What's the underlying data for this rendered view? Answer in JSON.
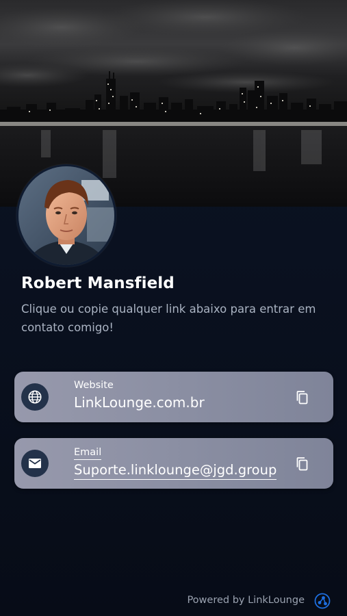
{
  "profile": {
    "name": "Robert Mansfield",
    "bio": "Clique ou copie qualquer link abaixo para entrar em contato comigo!"
  },
  "cover": {
    "description_icon": "city-skyline-night"
  },
  "links": [
    {
      "label": "Website",
      "value": "LinkLounge.com.br",
      "icon": "globe-icon",
      "action_icon": "copy-icon"
    },
    {
      "label": "Email",
      "value": "Suporte.linklounge@jgd.group",
      "icon": "mail-icon",
      "action_icon": "copy-icon"
    }
  ],
  "footer": {
    "powered_by": "Powered by LinkLounge",
    "logo_icon": "linklounge-logo-icon"
  },
  "colors": {
    "background": "#0b1220",
    "card": "#8b8fa3",
    "icon_circle": "#23324a",
    "brand": "#1e6fe0"
  }
}
